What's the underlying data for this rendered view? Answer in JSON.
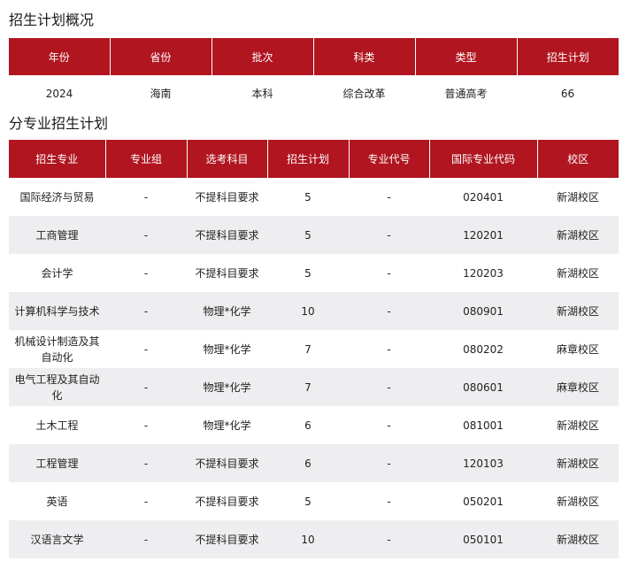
{
  "summary": {
    "title": "招生计划概况",
    "headers": [
      "年份",
      "省份",
      "批次",
      "科类",
      "类型",
      "招生计划"
    ],
    "row": [
      "2024",
      "海南",
      "本科",
      "综合改革",
      "普通高考",
      "66"
    ]
  },
  "majors": {
    "title": "分专业招生计划",
    "headers": [
      "招生专业",
      "专业组",
      "选考科目",
      "招生计划",
      "专业代号",
      "国际专业代码",
      "校区"
    ],
    "rows": [
      [
        "国际经济与贸易",
        "-",
        "不提科目要求",
        "5",
        "-",
        "020401",
        "新湖校区"
      ],
      [
        "工商管理",
        "-",
        "不提科目要求",
        "5",
        "-",
        "120201",
        "新湖校区"
      ],
      [
        "会计学",
        "-",
        "不提科目要求",
        "5",
        "-",
        "120203",
        "新湖校区"
      ],
      [
        "计算机科学与技术",
        "-",
        "物理*化学",
        "10",
        "-",
        "080901",
        "新湖校区"
      ],
      [
        "机械设计制造及其自动化",
        "-",
        "物理*化学",
        "7",
        "-",
        "080202",
        "麻章校区"
      ],
      [
        "电气工程及其自动化",
        "-",
        "物理*化学",
        "7",
        "-",
        "080601",
        "麻章校区"
      ],
      [
        "土木工程",
        "-",
        "物理*化学",
        "6",
        "-",
        "081001",
        "新湖校区"
      ],
      [
        "工程管理",
        "-",
        "不提科目要求",
        "6",
        "-",
        "120103",
        "新湖校区"
      ],
      [
        "英语",
        "-",
        "不提科目要求",
        "5",
        "-",
        "050201",
        "新湖校区"
      ],
      [
        "汉语言文学",
        "-",
        "不提科目要求",
        "10",
        "-",
        "050101",
        "新湖校区"
      ]
    ]
  }
}
